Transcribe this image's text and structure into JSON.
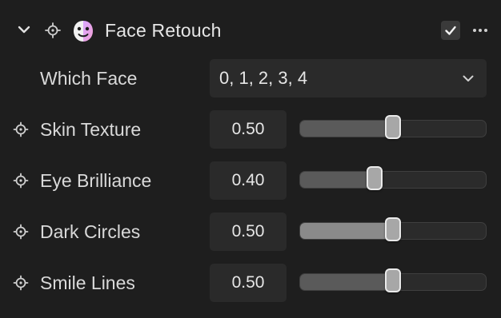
{
  "header": {
    "title": "Face Retouch",
    "expand_icon": "chevron-down-icon",
    "target_icon": "crosshair-icon",
    "node_icon": "face-retouch-icon",
    "enabled": true,
    "more_icon": "more-horizontal-icon"
  },
  "which_face": {
    "label": "Which Face",
    "value": "0, 1, 2, 3, 4",
    "dropdown_icon": "chevron-down-icon"
  },
  "params": [
    {
      "label": "Skin Texture",
      "value": "0.50",
      "level": 0.5,
      "fill_style": "dim"
    },
    {
      "label": "Eye Brilliance",
      "value": "0.40",
      "level": 0.4,
      "fill_style": "dim"
    },
    {
      "label": "Dark Circles",
      "value": "0.50",
      "level": 0.5,
      "fill_style": "bright"
    },
    {
      "label": "Smile Lines",
      "value": "0.50",
      "level": 0.5,
      "fill_style": "dim"
    }
  ],
  "colors": {
    "background": "#1e1e1e",
    "field": "#2a2a2a",
    "icon_gradient_start": "#d9a7ff",
    "icon_gradient_end": "#f2a2d6"
  }
}
